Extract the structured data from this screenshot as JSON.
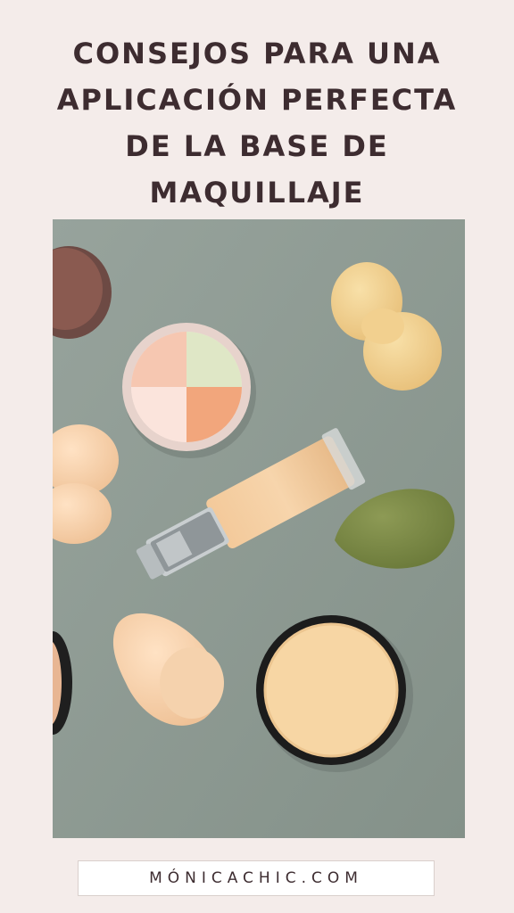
{
  "title": {
    "line1": "CONSEJOS PARA UNA",
    "line2": "APLICACIÓN PERFECTA",
    "line3": "DE LA BASE DE",
    "line4": "MAQUILLAJE"
  },
  "footer": {
    "site": "MÓNICACHIC.COM"
  },
  "image": {
    "icon": "makeup-products-photo",
    "colors": {
      "background": "#8e9b94",
      "text": "#3d2c30",
      "page": "#f4ecea"
    }
  }
}
